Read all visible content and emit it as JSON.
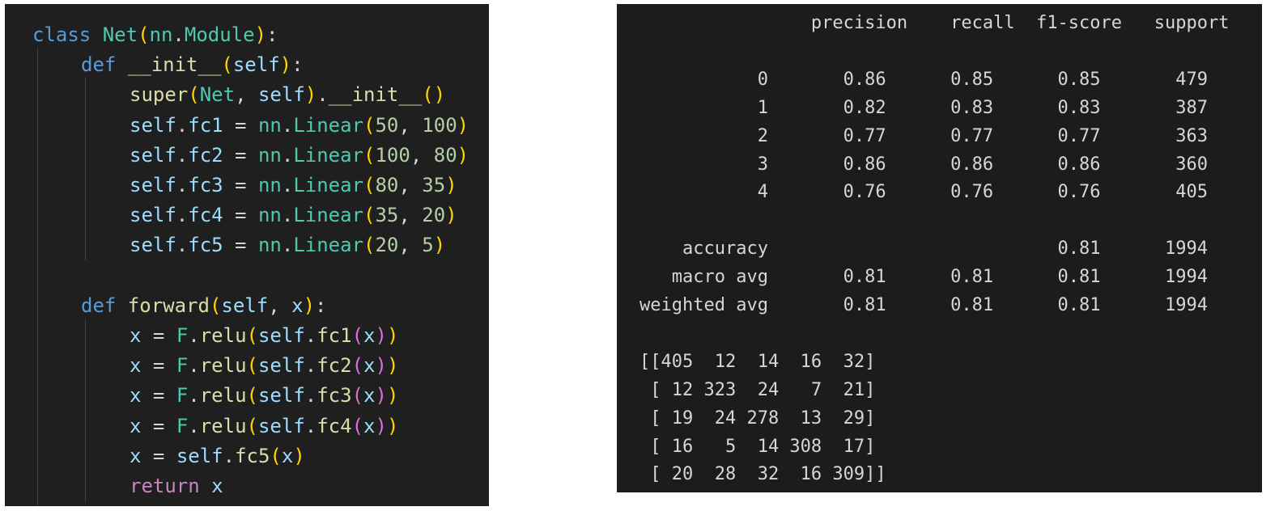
{
  "code_editor": {
    "lines": [
      [
        [
          "kw",
          "class "
        ],
        [
          "cls",
          "Net"
        ],
        [
          "b1",
          "("
        ],
        [
          "cls",
          "nn"
        ],
        [
          "op",
          "."
        ],
        [
          "cls",
          "Module"
        ],
        [
          "b1",
          ")"
        ],
        [
          "op",
          ":"
        ]
      ],
      [
        [
          "kw",
          "def "
        ],
        [
          "fn",
          "__init__"
        ],
        [
          "b1",
          "("
        ],
        [
          "var",
          "self"
        ],
        [
          "b1",
          ")"
        ],
        [
          "op",
          ":"
        ]
      ],
      [
        [
          "fn",
          "super"
        ],
        [
          "b1",
          "("
        ],
        [
          "cls",
          "Net"
        ],
        [
          "op",
          ", "
        ],
        [
          "var",
          "self"
        ],
        [
          "b1",
          ")"
        ],
        [
          "op",
          "."
        ],
        [
          "fn",
          "__init__"
        ],
        [
          "b1",
          "()"
        ]
      ],
      [
        [
          "var",
          "self"
        ],
        [
          "op",
          "."
        ],
        [
          "var",
          "fc1"
        ],
        [
          "op",
          " = "
        ],
        [
          "cls",
          "nn"
        ],
        [
          "op",
          "."
        ],
        [
          "cls",
          "Linear"
        ],
        [
          "b1",
          "("
        ],
        [
          "num",
          "50"
        ],
        [
          "op",
          ", "
        ],
        [
          "num",
          "100"
        ],
        [
          "b1",
          ")"
        ]
      ],
      [
        [
          "var",
          "self"
        ],
        [
          "op",
          "."
        ],
        [
          "var",
          "fc2"
        ],
        [
          "op",
          " = "
        ],
        [
          "cls",
          "nn"
        ],
        [
          "op",
          "."
        ],
        [
          "cls",
          "Linear"
        ],
        [
          "b1",
          "("
        ],
        [
          "num",
          "100"
        ],
        [
          "op",
          ", "
        ],
        [
          "num",
          "80"
        ],
        [
          "b1",
          ")"
        ]
      ],
      [
        [
          "var",
          "self"
        ],
        [
          "op",
          "."
        ],
        [
          "var",
          "fc3"
        ],
        [
          "op",
          " = "
        ],
        [
          "cls",
          "nn"
        ],
        [
          "op",
          "."
        ],
        [
          "cls",
          "Linear"
        ],
        [
          "b1",
          "("
        ],
        [
          "num",
          "80"
        ],
        [
          "op",
          ", "
        ],
        [
          "num",
          "35"
        ],
        [
          "b1",
          ")"
        ]
      ],
      [
        [
          "var",
          "self"
        ],
        [
          "op",
          "."
        ],
        [
          "var",
          "fc4"
        ],
        [
          "op",
          " = "
        ],
        [
          "cls",
          "nn"
        ],
        [
          "op",
          "."
        ],
        [
          "cls",
          "Linear"
        ],
        [
          "b1",
          "("
        ],
        [
          "num",
          "35"
        ],
        [
          "op",
          ", "
        ],
        [
          "num",
          "20"
        ],
        [
          "b1",
          ")"
        ]
      ],
      [
        [
          "var",
          "self"
        ],
        [
          "op",
          "."
        ],
        [
          "var",
          "fc5"
        ],
        [
          "op",
          " = "
        ],
        [
          "cls",
          "nn"
        ],
        [
          "op",
          "."
        ],
        [
          "cls",
          "Linear"
        ],
        [
          "b1",
          "("
        ],
        [
          "num",
          "20"
        ],
        [
          "op",
          ", "
        ],
        [
          "num",
          "5"
        ],
        [
          "b1",
          ")"
        ]
      ],
      [],
      [
        [
          "kw",
          "def "
        ],
        [
          "fn",
          "forward"
        ],
        [
          "b1",
          "("
        ],
        [
          "var",
          "self"
        ],
        [
          "op",
          ", "
        ],
        [
          "var",
          "x"
        ],
        [
          "b1",
          ")"
        ],
        [
          "op",
          ":"
        ]
      ],
      [
        [
          "var",
          "x"
        ],
        [
          "op",
          " = "
        ],
        [
          "cls",
          "F"
        ],
        [
          "op",
          "."
        ],
        [
          "fn",
          "relu"
        ],
        [
          "b1",
          "("
        ],
        [
          "var",
          "self"
        ],
        [
          "op",
          "."
        ],
        [
          "fn",
          "fc1"
        ],
        [
          "b2",
          "("
        ],
        [
          "var",
          "x"
        ],
        [
          "b2",
          ")"
        ],
        [
          "b1",
          ")"
        ]
      ],
      [
        [
          "var",
          "x"
        ],
        [
          "op",
          " = "
        ],
        [
          "cls",
          "F"
        ],
        [
          "op",
          "."
        ],
        [
          "fn",
          "relu"
        ],
        [
          "b1",
          "("
        ],
        [
          "var",
          "self"
        ],
        [
          "op",
          "."
        ],
        [
          "fn",
          "fc2"
        ],
        [
          "b2",
          "("
        ],
        [
          "var",
          "x"
        ],
        [
          "b2",
          ")"
        ],
        [
          "b1",
          ")"
        ]
      ],
      [
        [
          "var",
          "x"
        ],
        [
          "op",
          " = "
        ],
        [
          "cls",
          "F"
        ],
        [
          "op",
          "."
        ],
        [
          "fn",
          "relu"
        ],
        [
          "b1",
          "("
        ],
        [
          "var",
          "self"
        ],
        [
          "op",
          "."
        ],
        [
          "fn",
          "fc3"
        ],
        [
          "b2",
          "("
        ],
        [
          "var",
          "x"
        ],
        [
          "b2",
          ")"
        ],
        [
          "b1",
          ")"
        ]
      ],
      [
        [
          "var",
          "x"
        ],
        [
          "op",
          " = "
        ],
        [
          "cls",
          "F"
        ],
        [
          "op",
          "."
        ],
        [
          "fn",
          "relu"
        ],
        [
          "b1",
          "("
        ],
        [
          "var",
          "self"
        ],
        [
          "op",
          "."
        ],
        [
          "fn",
          "fc4"
        ],
        [
          "b2",
          "("
        ],
        [
          "var",
          "x"
        ],
        [
          "b2",
          ")"
        ],
        [
          "b1",
          ")"
        ]
      ],
      [
        [
          "var",
          "x"
        ],
        [
          "op",
          " = "
        ],
        [
          "var",
          "self"
        ],
        [
          "op",
          "."
        ],
        [
          "fn",
          "fc5"
        ],
        [
          "b1",
          "("
        ],
        [
          "var",
          "x"
        ],
        [
          "b1",
          ")"
        ]
      ],
      [
        [
          "ctl",
          "return "
        ],
        [
          "var",
          "x"
        ]
      ]
    ],
    "indent_levels": [
      0,
      1,
      2,
      2,
      2,
      2,
      2,
      2,
      0,
      1,
      2,
      2,
      2,
      2,
      2,
      2
    ]
  },
  "report_output": {
    "lines": [
      "                precision    recall  f1-score   support",
      "",
      "           0       0.86      0.85      0.85       479",
      "           1       0.82      0.83      0.83       387",
      "           2       0.77      0.77      0.77       363",
      "           3       0.86      0.86      0.86       360",
      "           4       0.76      0.76      0.76       405",
      "",
      "    accuracy                           0.81      1994",
      "   macro avg       0.81      0.81      0.81      1994",
      "weighted avg       0.81      0.81      0.81      1994",
      "",
      "[[405  12  14  16  32]",
      " [ 12 323  24   7  21]",
      " [ 19  24 278  13  29]",
      " [ 16   5  14 308  17]",
      " [ 20  28  32  16 309]]"
    ]
  }
}
